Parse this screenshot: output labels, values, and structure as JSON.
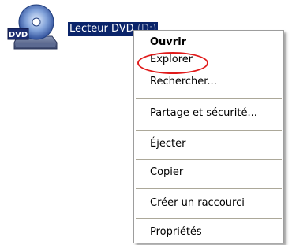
{
  "desktop": {
    "icon": "dvd-drive-icon",
    "icon_badge": "DVD",
    "label_visible": "Lecteur DVD",
    "label_truncated": " (D:)"
  },
  "context_menu": {
    "items": [
      {
        "label": "Ouvrir",
        "default": true
      },
      {
        "label": "Explorer",
        "highlighted": true
      },
      {
        "label": "Rechercher..."
      },
      {
        "label": "Partage et sécurité..."
      },
      {
        "label": "Éjecter"
      },
      {
        "label": "Copier"
      },
      {
        "label": "Créer un raccourci"
      },
      {
        "label": "Propriétés"
      }
    ]
  },
  "colors": {
    "selection_bg": "#0a246a",
    "annotation_circle": "#e01a1a",
    "separator": "#aca899"
  }
}
